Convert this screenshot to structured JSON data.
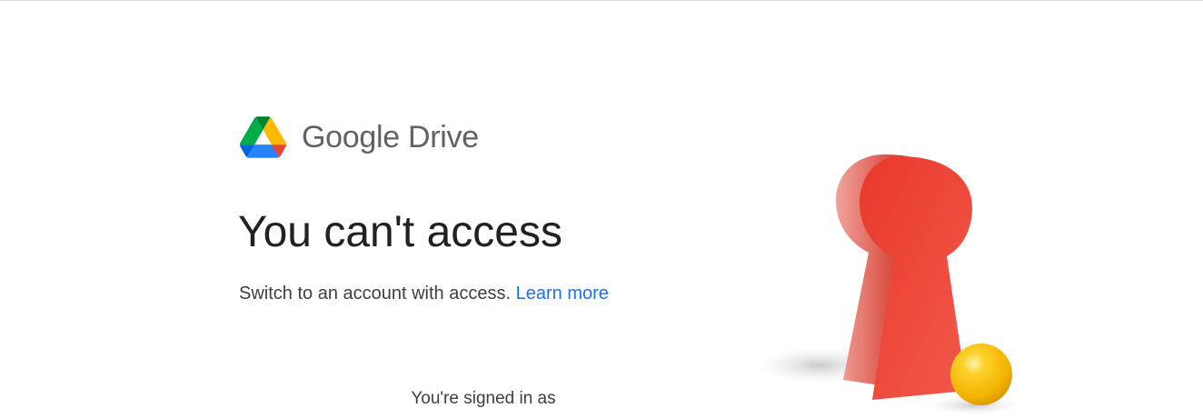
{
  "brand": {
    "product_name": "Google Drive",
    "logo_icon": "google-drive-icon",
    "colors": {
      "green": "#0f9d58",
      "yellow": "#f4b400",
      "blue": "#4285f4",
      "red": "#ea4335"
    }
  },
  "main": {
    "headline": "You can't access",
    "subtext": "Switch to an account with access.",
    "learn_more_label": "Learn more",
    "signed_in_text": "You're signed in as"
  },
  "illustration": {
    "icon": "keyhole-with-ball-illustration",
    "keyhole_color": "#ea4335",
    "ball_color": "#fbbc04"
  },
  "theme": {
    "link_color": "#1a73e8",
    "headline_color": "#202124",
    "body_text_color": "#3c4043",
    "product_name_color": "#5f6368"
  }
}
